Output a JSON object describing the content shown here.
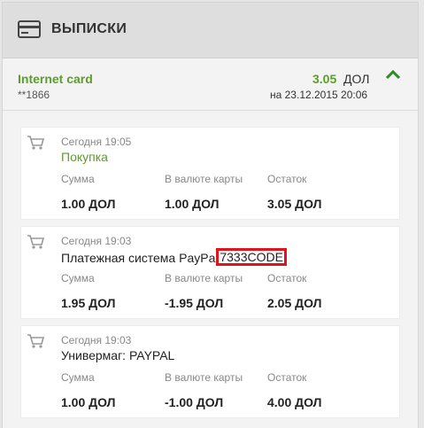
{
  "header": {
    "title": "ВЫПИСКИ",
    "icon": "credit-card-icon"
  },
  "account": {
    "name": "Internet card",
    "number": "**1866",
    "balance": "3.05",
    "currency": "ДОЛ",
    "date": "на 23.12.2015 20:06",
    "accent_color": "#5b9e28"
  },
  "columns": {
    "amount": "Сумма",
    "card_currency": "В валюте карты",
    "balance": "Остаток"
  },
  "transactions": [
    {
      "time": "Сегодня 19:05",
      "description": "Покупка",
      "amount": "1.00 ДОЛ",
      "card_amount": "1.00 ДОЛ",
      "balance": "3.05 ДОЛ"
    },
    {
      "time": "Сегодня 19:03",
      "description": "Платежная система PayPa",
      "highlight": "7333CODE",
      "highlight_color": "#e0141e",
      "amount": "1.95 ДОЛ",
      "card_amount": "-1.95 ДОЛ",
      "balance": "2.05 ДОЛ"
    },
    {
      "time": "Сегодня 19:03",
      "description": "Универмаг: PAYPAL",
      "amount": "1.00 ДОЛ",
      "card_amount": "-1.00 ДОЛ",
      "balance": "4.00 ДОЛ"
    }
  ]
}
